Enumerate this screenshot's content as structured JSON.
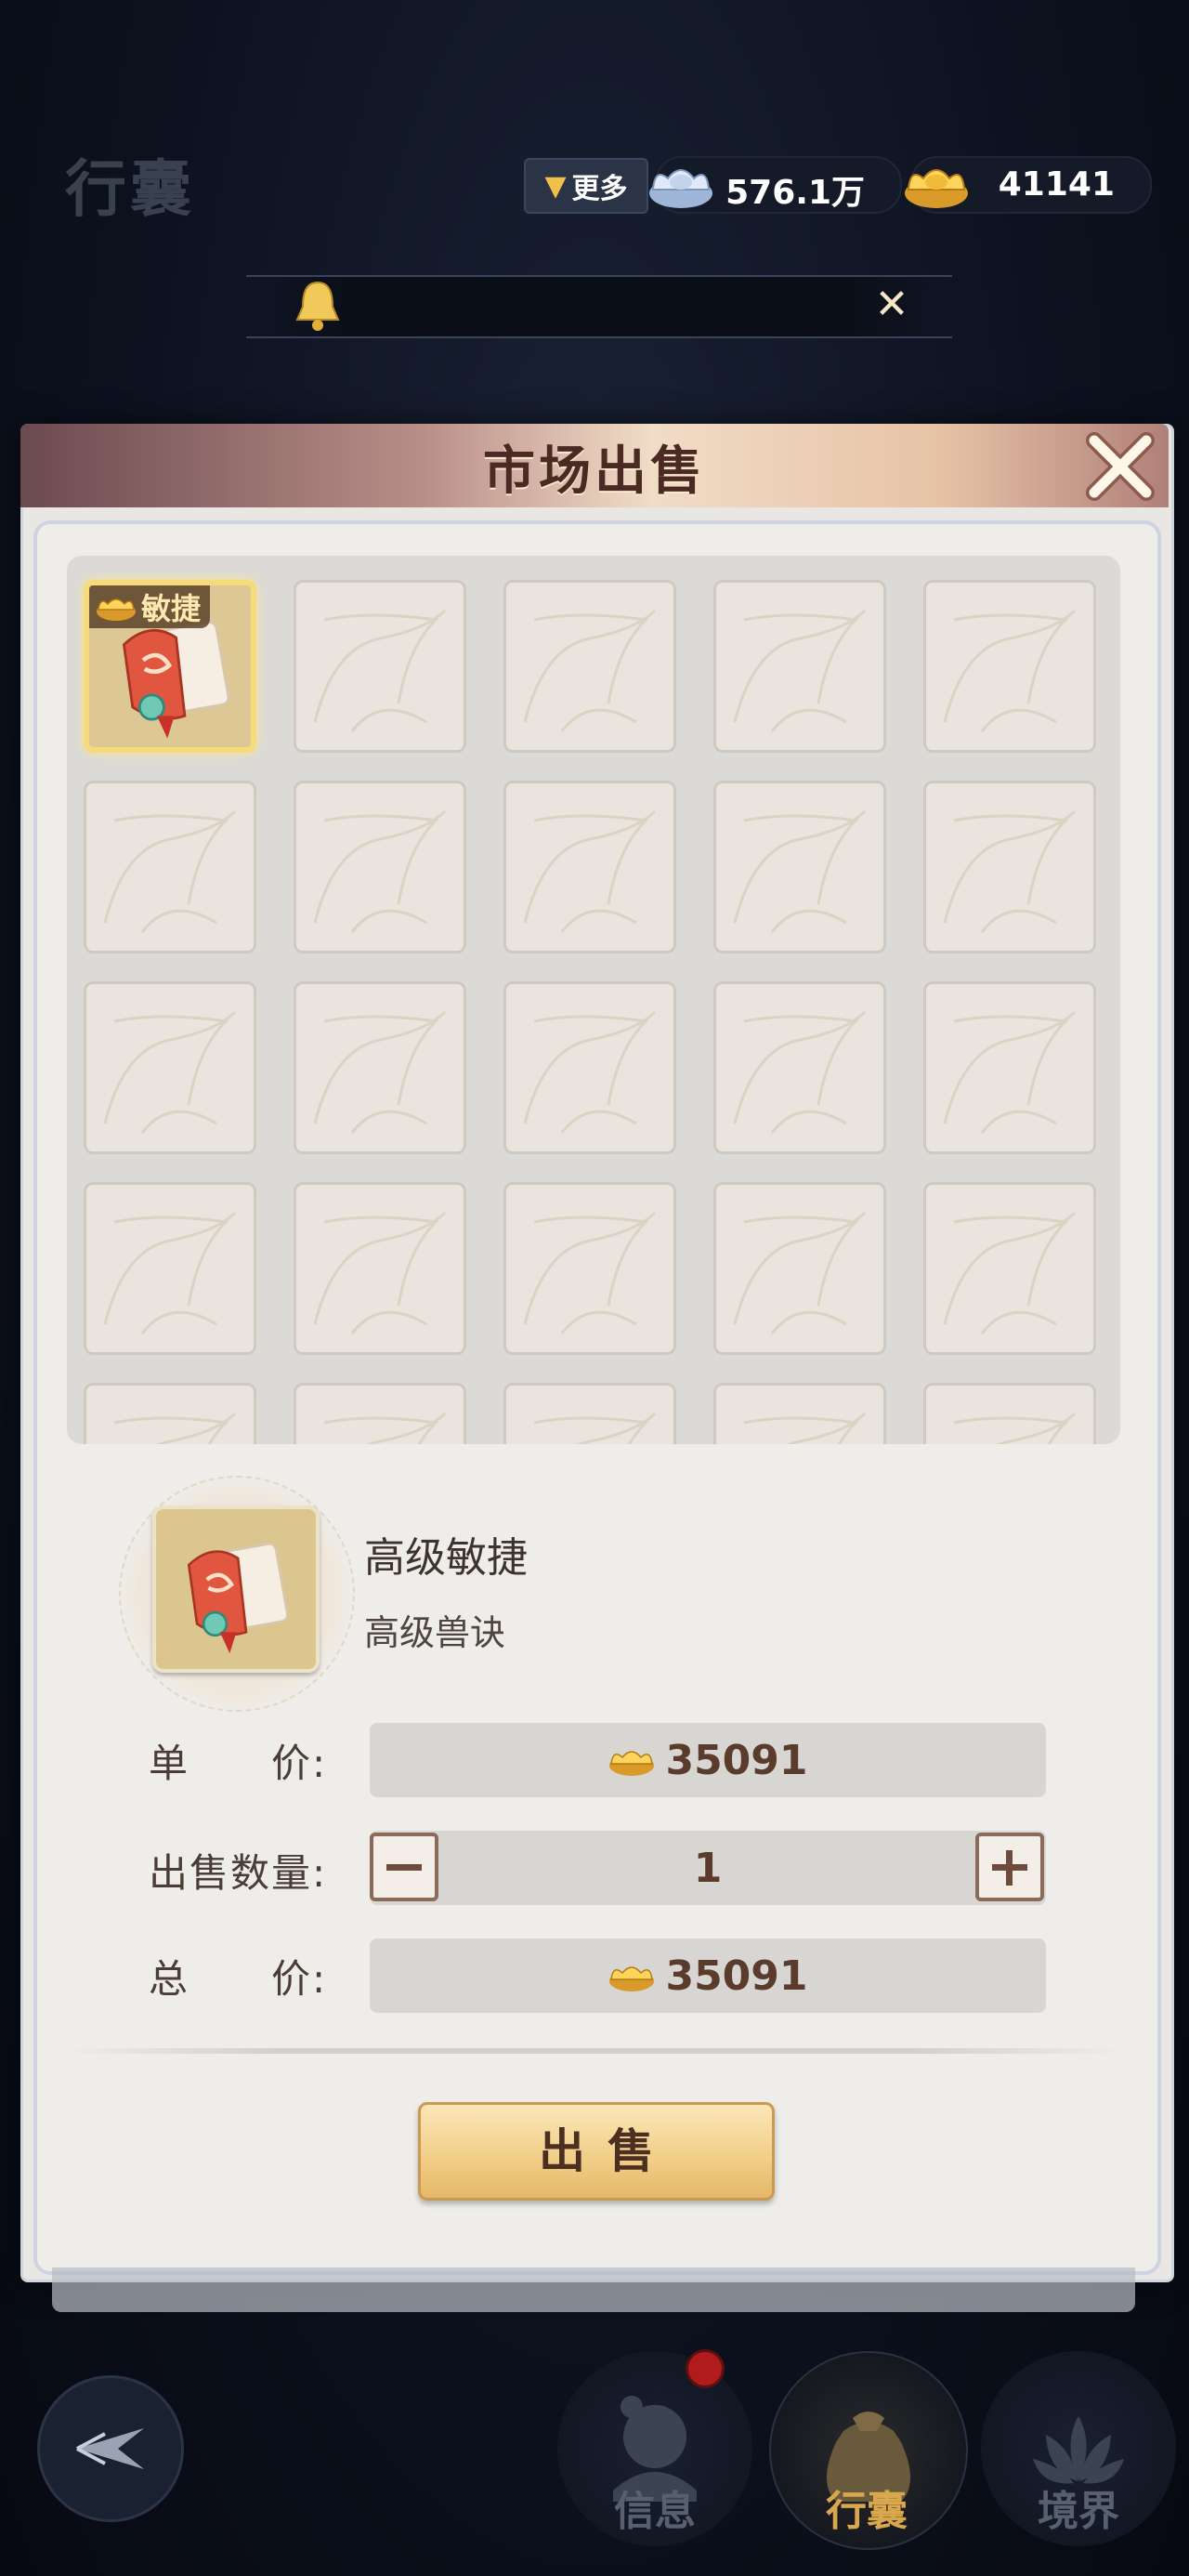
{
  "header": {
    "title": "行囊",
    "more_label": "更多",
    "currencies": [
      {
        "icon": "silver-ingot-icon",
        "value": "576.1万"
      },
      {
        "icon": "gold-ingot-icon",
        "value": "41141"
      }
    ]
  },
  "notice": {
    "icon": "bell-icon",
    "close_icon": "close-icon"
  },
  "dialog": {
    "title": "市场出售",
    "grid": {
      "selected_item": {
        "tag": "敏捷",
        "tag_icon": "gold-ingot-icon",
        "icon": "skill-scroll-icon"
      },
      "slot_count": 25
    },
    "detail": {
      "name": "高级敏捷",
      "type": "高级兽诀",
      "unit_price_label": "单　　价:",
      "unit_price": "35091",
      "quantity_label": "出售数量:",
      "quantity": "1",
      "total_label": "总　　价:",
      "total_price": "35091"
    },
    "sell_button": "出售"
  },
  "bottom_nav": [
    {
      "label": "信息",
      "icon": "character-icon",
      "active": false,
      "has_badge": true
    },
    {
      "label": "行囊",
      "icon": "bag-icon",
      "active": true,
      "has_badge": false
    },
    {
      "label": "境界",
      "icon": "lotus-icon",
      "active": false,
      "has_badge": false
    }
  ],
  "colors": {
    "active_nav": "#d9a74c",
    "inactive_nav": "#58606e",
    "price_text": "#5a3b2c"
  }
}
